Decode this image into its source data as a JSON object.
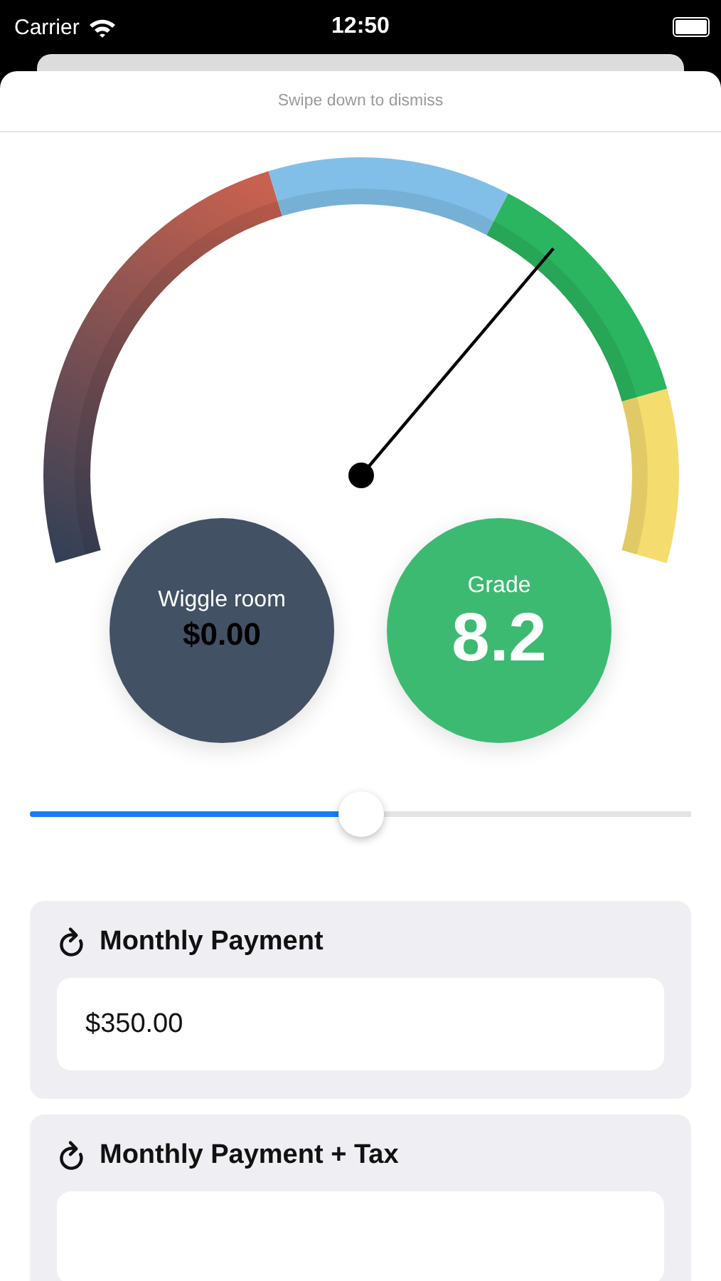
{
  "status_bar": {
    "carrier": "Carrier",
    "time": "12:50"
  },
  "sheet": {
    "hint": "Swipe down to dismiss"
  },
  "gauge": {
    "segments": [
      {
        "kind": "gradient",
        "color": "#c8614f"
      },
      {
        "kind": "solid",
        "color": "#82bfe8"
      },
      {
        "kind": "solid",
        "color": "#2cb560"
      },
      {
        "kind": "solid",
        "color": "#f5dc6f"
      }
    ],
    "level": 0.69
  },
  "stats": [
    {
      "kind": "small",
      "label": "Wiggle room",
      "value": "$0.00",
      "color": "#435165"
    },
    {
      "kind": "large",
      "label": "Grade",
      "value": "8.2",
      "color": "#3dba72"
    }
  ],
  "slider": {
    "level": 0.5
  },
  "fields": [
    {
      "label": "Monthly Payment",
      "value": "$350.00"
    },
    {
      "label": "Monthly Payment + Tax"
    }
  ]
}
